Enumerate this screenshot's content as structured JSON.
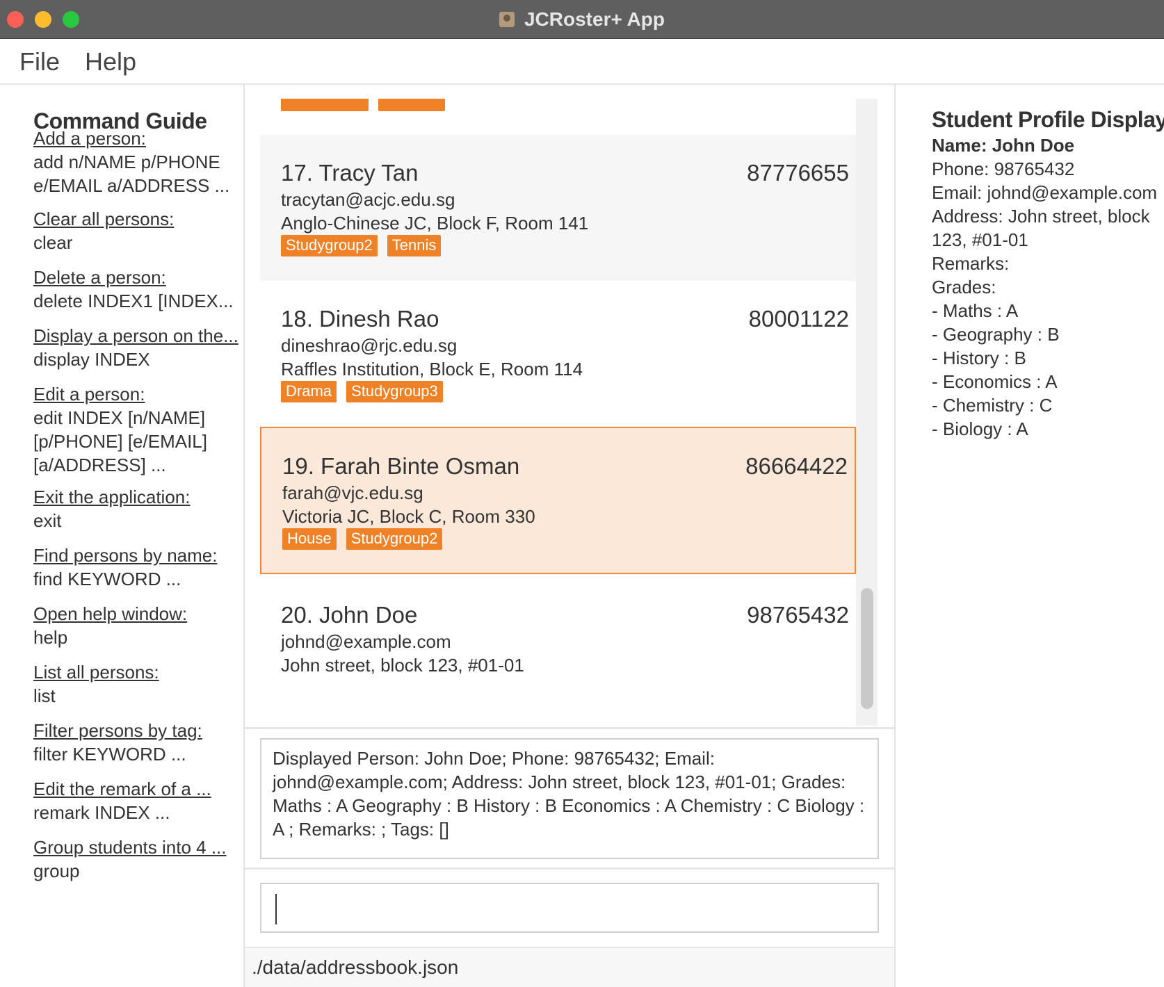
{
  "window": {
    "title": "JCRoster+ App"
  },
  "menu": {
    "file": "File",
    "help": "Help"
  },
  "guide": {
    "title": "Command Guide",
    "commands": [
      {
        "label": "Add a person:",
        "usage": "add n/NAME p/PHONE\ne/EMAIL a/ADDRESS ..."
      },
      {
        "label": "Clear all persons:",
        "usage": "clear"
      },
      {
        "label": "Delete a person:",
        "usage": "delete INDEX1 [INDEX..."
      },
      {
        "label": "Display a person on the...",
        "usage": "display INDEX"
      },
      {
        "label": "Edit a person:",
        "usage": "edit INDEX [n/NAME]\n[p/PHONE] [e/EMAIL]\n[a/ADDRESS] ..."
      },
      {
        "label": "Exit the application:",
        "usage": "exit"
      },
      {
        "label": "Find persons by name:",
        "usage": "find KEYWORD ..."
      },
      {
        "label": "Open help window:",
        "usage": "help"
      },
      {
        "label": "List all persons:",
        "usage": "list"
      },
      {
        "label": "Filter persons by tag:",
        "usage": "filter KEYWORD ..."
      },
      {
        "label": "Edit the remark of a ...",
        "usage": "remark INDEX ..."
      },
      {
        "label": "Group students into 4 ...",
        "usage": "group"
      }
    ]
  },
  "persons": [
    {
      "name": "17. Tracy Tan",
      "phone": "87776655",
      "email": "tracytan@acjc.edu.sg",
      "address": "Anglo-Chinese JC, Block F, Room 141",
      "tags": [
        "Studygroup2",
        "Tennis"
      ]
    },
    {
      "name": "18. Dinesh Rao",
      "phone": "80001122",
      "email": "dineshrao@rjc.edu.sg",
      "address": "Raffles Institution, Block E, Room 114",
      "tags": [
        "Drama",
        "Studygroup3"
      ]
    },
    {
      "name": "19. Farah Binte Osman",
      "phone": "86664422",
      "email": "farah@vjc.edu.sg",
      "address": "Victoria JC, Block C, Room 330",
      "tags": [
        "House",
        "Studygroup2"
      ]
    },
    {
      "name": "20. John Doe",
      "phone": "98765432",
      "email": "johnd@example.com",
      "address": "John street, block 123, #01-01",
      "tags": []
    }
  ],
  "result": {
    "text": "Displayed Person: John Doe; Phone: 98765432; Email: johnd@example.com; Address: John street, block 123, #01-01; Grades: Maths : A Geography : B History : B Economics : A Chemistry : C Biology : A ; Remarks: ; Tags: []"
  },
  "command_box": {
    "value": ""
  },
  "status": {
    "path": "./data/addressbook.json"
  },
  "profile": {
    "title": "Student Profile Display:",
    "name": "Name: John Doe",
    "phone": "Phone: 98765432",
    "email": "Email: johnd@example.com",
    "address": "Address: John street, block 123, #01-01",
    "remarks": "Remarks:",
    "grades_label": "Grades:",
    "grades": [
      "- Maths : A",
      "- Geography : B",
      "- History : B",
      "- Economics : A",
      "- Chemistry : C",
      "- Biology : A"
    ]
  },
  "colors": {
    "tag": "#ef8127",
    "selected_bg": "#fbe8d8",
    "selected_border": "#ef8a3a"
  }
}
